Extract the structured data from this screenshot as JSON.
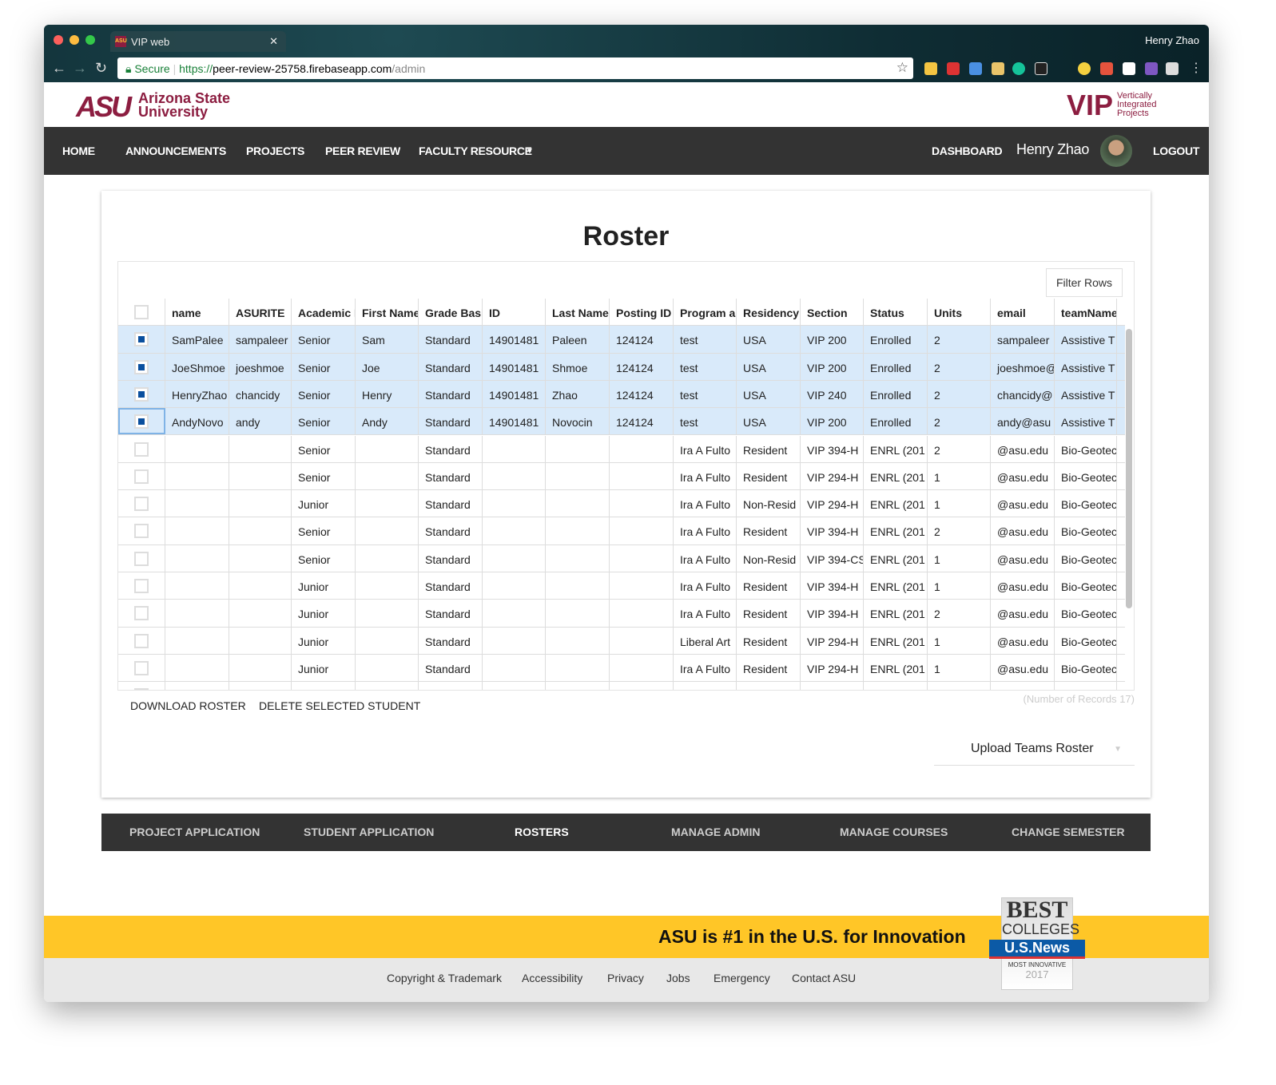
{
  "browser": {
    "tab_title": "VIP web",
    "profile": "Henry Zhao",
    "secure_label": "Secure",
    "url_protocol": "https://",
    "url_host": "peer-review-25758.firebaseapp.com",
    "url_path": "/admin"
  },
  "header": {
    "asu_logo": "ASU",
    "asu_name": "Arizona State University",
    "vip_logo": "VIP",
    "vip_text": "Vertically Integrated Projects",
    "brand_color": "#8c1d40",
    "gold_color": "#ffc627"
  },
  "nav": {
    "items": [
      "HOME",
      "ANNOUNCEMENTS",
      "PROJECTS",
      "PEER REVIEW",
      "FACULTY RESOURCE"
    ],
    "dashboard": "DASHBOARD",
    "user_name": "Henry Zhao",
    "logout": "LOGOUT"
  },
  "page": {
    "title": "Roster",
    "filter_label": "Filter Rows",
    "download": "DOWNLOAD ROSTER",
    "delete": "DELETE SELECTED STUDENT",
    "records": "(Number of Records 17)",
    "upload": "Upload Teams Roster"
  },
  "table": {
    "columns": [
      "name",
      "ASURITE",
      "Academic L",
      "First Name",
      "Grade Basis",
      "ID",
      "Last Name",
      "Posting ID",
      "Program an",
      "Residency",
      "Section",
      "Status",
      "Units",
      "email",
      "teamName"
    ],
    "rows": [
      {
        "selected": true,
        "cells": [
          "SamPalee",
          "sampaleer",
          "Senior",
          "Sam",
          "Standard",
          "14901481",
          "Paleen",
          "124124",
          "test",
          "USA",
          "VIP 200",
          "Enrolled",
          "2",
          "sampaleer",
          "Assistive T"
        ]
      },
      {
        "selected": true,
        "cells": [
          "JoeShmoe",
          "joeshmoe",
          "Senior",
          "Joe",
          "Standard",
          "14901481",
          "Shmoe",
          "124124",
          "test",
          "USA",
          "VIP 200",
          "Enrolled",
          "2",
          "joeshmoe@",
          "Assistive T"
        ]
      },
      {
        "selected": true,
        "cells": [
          "HenryZhao",
          "chancidy",
          "Senior",
          "Henry",
          "Standard",
          "14901481",
          "Zhao",
          "124124",
          "test",
          "USA",
          "VIP 240",
          "Enrolled",
          "2",
          "chancidy@",
          "Assistive T"
        ]
      },
      {
        "selected": true,
        "cells": [
          "AndyNovo",
          "andy",
          "Senior",
          "Andy",
          "Standard",
          "14901481",
          "Novocin",
          "124124",
          "test",
          "USA",
          "VIP 200",
          "Enrolled",
          "2",
          "andy@asu",
          "Assistive T"
        ]
      },
      {
        "selected": false,
        "cells": [
          "",
          "",
          "Senior",
          "",
          "Standard",
          "",
          "",
          "",
          "Ira A Fulto",
          "Resident",
          "VIP 394-H",
          "ENRL (201",
          "2",
          "@asu.edu",
          "Bio-Geotec"
        ]
      },
      {
        "selected": false,
        "cells": [
          "",
          "",
          "Senior",
          "",
          "Standard",
          "",
          "",
          "",
          "Ira A Fulto",
          "Resident",
          "VIP 294-H",
          "ENRL (201",
          "1",
          "@asu.edu",
          "Bio-Geotec"
        ]
      },
      {
        "selected": false,
        "cells": [
          "",
          "",
          "Junior",
          "",
          "Standard",
          "",
          "",
          "",
          "Ira A Fulto",
          "Non-Resid",
          "VIP 294-H",
          "ENRL (201",
          "1",
          "@asu.edu",
          "Bio-Geotec"
        ]
      },
      {
        "selected": false,
        "cells": [
          "",
          "",
          "Senior",
          "",
          "Standard",
          "",
          "",
          "",
          "Ira A Fulto",
          "Resident",
          "VIP 394-H",
          "ENRL (201",
          "2",
          "@asu.edu",
          "Bio-Geotec"
        ]
      },
      {
        "selected": false,
        "cells": [
          "",
          "",
          "Senior",
          "",
          "Standard",
          "",
          "",
          "",
          "Ira A Fulto",
          "Non-Resid",
          "VIP 394-CS",
          "ENRL (201",
          "1",
          "@asu.edu",
          "Bio-Geotec"
        ]
      },
      {
        "selected": false,
        "cells": [
          "",
          "",
          "Junior",
          "",
          "Standard",
          "",
          "",
          "",
          "Ira A Fulto",
          "Resident",
          "VIP 394-H",
          "ENRL (201",
          "1",
          "@asu.edu",
          "Bio-Geotec"
        ]
      },
      {
        "selected": false,
        "cells": [
          "",
          "",
          "Junior",
          "",
          "Standard",
          "",
          "",
          "",
          "Ira A Fulto",
          "Resident",
          "VIP 394-H",
          "ENRL (201",
          "2",
          "@asu.edu",
          "Bio-Geotec"
        ]
      },
      {
        "selected": false,
        "cells": [
          "",
          "",
          "Junior",
          "",
          "Standard",
          "",
          "",
          "",
          "Liberal Art",
          "Resident",
          "VIP 294-H",
          "ENRL (201",
          "1",
          "@asu.edu",
          "Bio-Geotec"
        ]
      },
      {
        "selected": false,
        "cells": [
          "",
          "",
          "Junior",
          "",
          "Standard",
          "",
          "",
          "",
          "Ira A Fulto",
          "Resident",
          "VIP 294-H",
          "ENRL (201",
          "1",
          "@asu.edu",
          "Bio-Geotec"
        ]
      }
    ]
  },
  "subnav": {
    "items": [
      "PROJECT APPLICATION",
      "STUDENT APPLICATION",
      "ROSTERS",
      "MANAGE ADMIN",
      "MANAGE COURSES",
      "CHANGE SEMESTER"
    ],
    "active": "ROSTERS"
  },
  "footer": {
    "banner": "ASU is #1 in the U.S. for Innovation",
    "links": [
      "Copyright & Trademark",
      "Accessibility",
      "Privacy",
      "Jobs",
      "Emergency",
      "Contact ASU"
    ],
    "badge": {
      "line1": "BEST",
      "line2": "COLLEGES",
      "line3": "U.S.News",
      "line4": "MOST INNOVATIVE",
      "year": "2017"
    }
  }
}
